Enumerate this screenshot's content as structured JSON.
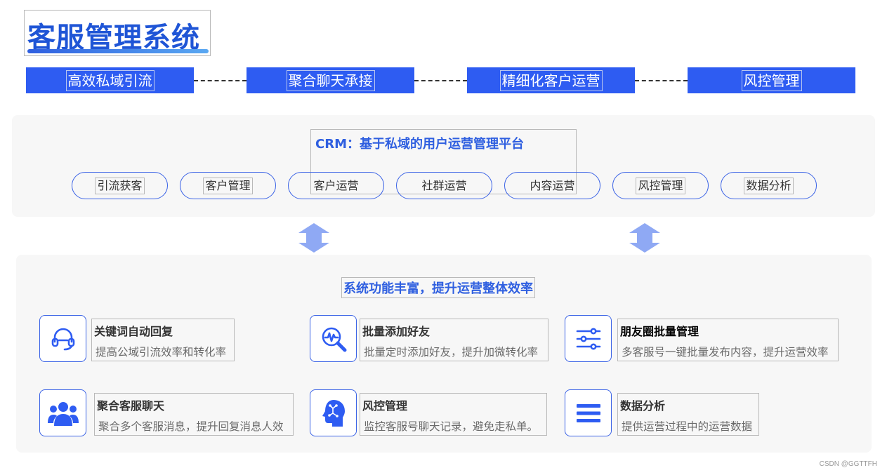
{
  "title": "客服管理系统",
  "flow": [
    "高效私域引流",
    "聚合聊天承接",
    "精细化客户运营",
    "风控管理"
  ],
  "crm": {
    "title": "CRM：基于私域的用户运营管理平台",
    "modules": [
      "引流获客",
      "客户管理",
      "客户运营",
      "社群运营",
      "内容运营",
      "风控管理",
      "数据分析"
    ]
  },
  "features": {
    "heading": "系统功能丰富，提升运营整体效率",
    "items": [
      {
        "icon": "headset-icon",
        "title": "关键词自动回复",
        "desc": "提高公域引流效率和转化率"
      },
      {
        "icon": "magnifier-chart-icon",
        "title": "批量添加好友",
        "desc": "批量定时添加好友，提升加微转化率"
      },
      {
        "icon": "sliders-icon",
        "title": "朋友圈批量管理",
        "desc": "多客服号一键批量发布内容，提升运营效率"
      },
      {
        "icon": "users-icon",
        "title": "聚合客服聊天",
        "desc": "聚合多个客服消息，提升回复消息人效"
      },
      {
        "icon": "brain-head-icon",
        "title": "风控管理",
        "desc": "监控客服号聊天记录，避免走私单。"
      },
      {
        "icon": "list-icon",
        "title": "数据分析",
        "desc": "提供运营过程中的运营数据"
      }
    ]
  },
  "colors": {
    "accent": "#2e5cf2",
    "arrow": "#8fa9f4",
    "panel": "#f7f7f7"
  },
  "watermark": "CSDN @GGTTFH"
}
